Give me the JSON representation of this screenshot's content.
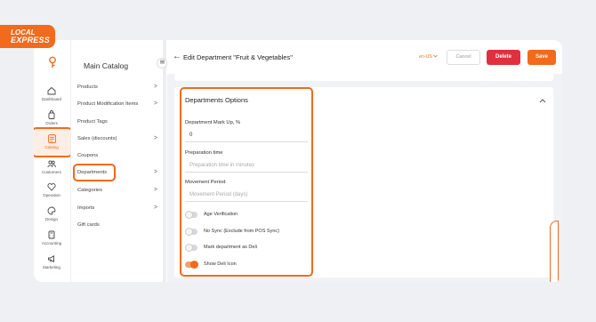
{
  "brand": {
    "line1": "LOCAL",
    "line2": "EXPRESS"
  },
  "rail": [
    {
      "label": "Dashboard",
      "icon": "home-icon"
    },
    {
      "label": "Orders",
      "icon": "bag-icon"
    },
    {
      "label": "Catalog",
      "icon": "clipboard-icon",
      "active": true
    },
    {
      "label": "Customers",
      "icon": "users-icon"
    },
    {
      "label": "Operation",
      "icon": "heart-icon"
    },
    {
      "label": "Design",
      "icon": "palette-icon"
    },
    {
      "label": "Accounting",
      "icon": "calculator-icon"
    },
    {
      "label": "Marketing",
      "icon": "megaphone-icon"
    }
  ],
  "menu": {
    "title": "Main Catalog",
    "items": [
      {
        "label": "Products",
        "chevron": ">"
      },
      {
        "label": "Product Modification Items",
        "chevron": ">"
      },
      {
        "label": "Product Tags",
        "chevron": ""
      },
      {
        "label": "Sales (discounts)",
        "chevron": ">"
      },
      {
        "label": "Coupons",
        "chevron": ""
      },
      {
        "label": "Departments",
        "chevron": ">"
      },
      {
        "label": "Categories",
        "chevron": ">"
      },
      {
        "label": "Imports",
        "chevron": ">"
      },
      {
        "label": "Gift cards",
        "chevron": ""
      }
    ]
  },
  "header": {
    "back": "←",
    "title": "Edit Department \"Fruit & Vegetables\"",
    "language": "en-US",
    "cancel": "Cancel",
    "delete": "Delete",
    "save": "Save"
  },
  "card": {
    "title": "Departments Options",
    "collapse": "^",
    "markup_label": "Department Mark Up, %",
    "markup_value": "0",
    "prep_label": "Preparation time",
    "prep_placeholder": "Preparation time in minutes",
    "movement_label": "Movement Period",
    "movement_placeholder": "Movement Period (days)",
    "toggles": [
      {
        "label": "Age Verification",
        "on": false
      },
      {
        "label": "No Sync (Exclude from POS Sync)",
        "on": false
      },
      {
        "label": "Mark department as Deli",
        "on": false
      },
      {
        "label": "Show Deli Icon",
        "on": true
      }
    ]
  },
  "colors": {
    "accent": "#f26a1b",
    "danger": "#e0303f"
  }
}
